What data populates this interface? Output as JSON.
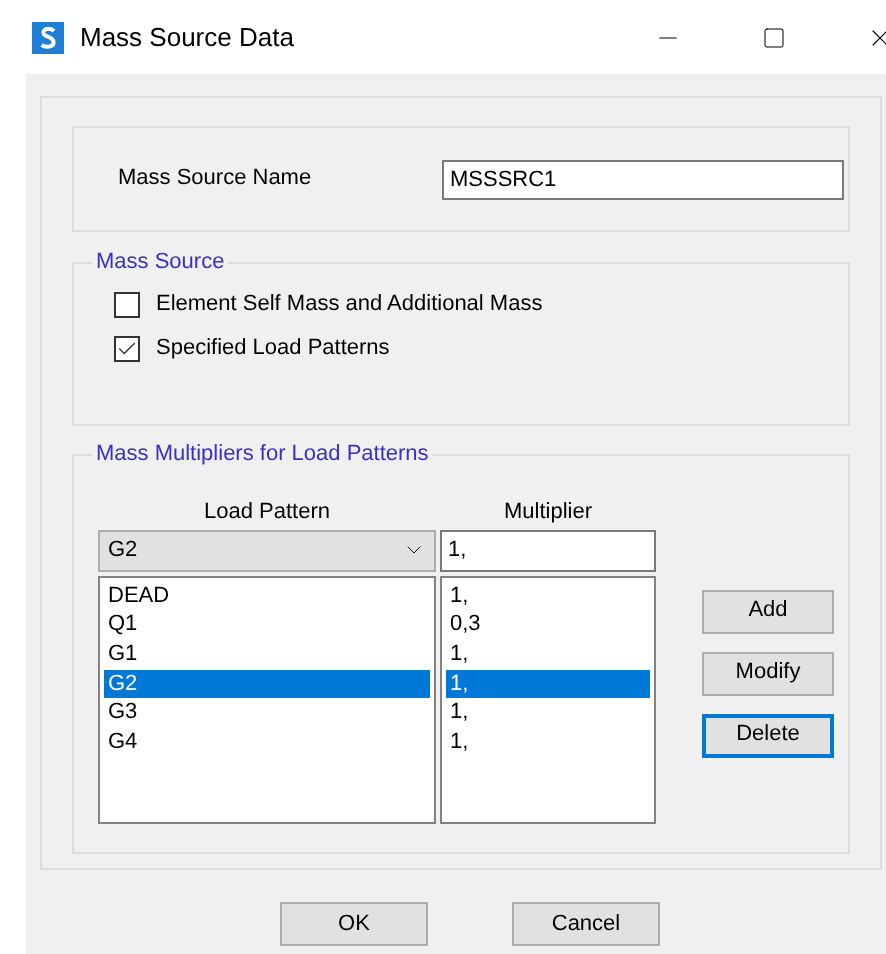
{
  "window": {
    "title": "Mass Source Data"
  },
  "mass_source_name": {
    "label": "Mass Source Name",
    "value": "MSSSRC1"
  },
  "mass_source": {
    "title": "Mass Source",
    "options": [
      {
        "label": "Element Self Mass and Additional Mass",
        "checked": false
      },
      {
        "label": "Specified Load Patterns",
        "checked": true
      }
    ]
  },
  "multipliers": {
    "title": "Mass Multipliers for Load Patterns",
    "columns": [
      "Load Pattern",
      "Multiplier"
    ],
    "load_pattern_value": "G2",
    "multiplier_value": "1,",
    "rows": [
      {
        "load_pattern": "DEAD",
        "multiplier": "1,",
        "selected": false
      },
      {
        "load_pattern": "Q1",
        "multiplier": "0,3",
        "selected": false
      },
      {
        "load_pattern": "G1",
        "multiplier": "1,",
        "selected": false
      },
      {
        "load_pattern": "G2",
        "multiplier": "1,",
        "selected": true
      },
      {
        "load_pattern": "G3",
        "multiplier": "1,",
        "selected": false
      },
      {
        "load_pattern": "G4",
        "multiplier": "1,",
        "selected": false
      }
    ],
    "buttons": [
      {
        "label": "Add",
        "focused": false
      },
      {
        "label": "Modify",
        "focused": false
      },
      {
        "label": "Delete",
        "focused": true
      }
    ]
  },
  "buttons": [
    "OK",
    "Cancel"
  ]
}
